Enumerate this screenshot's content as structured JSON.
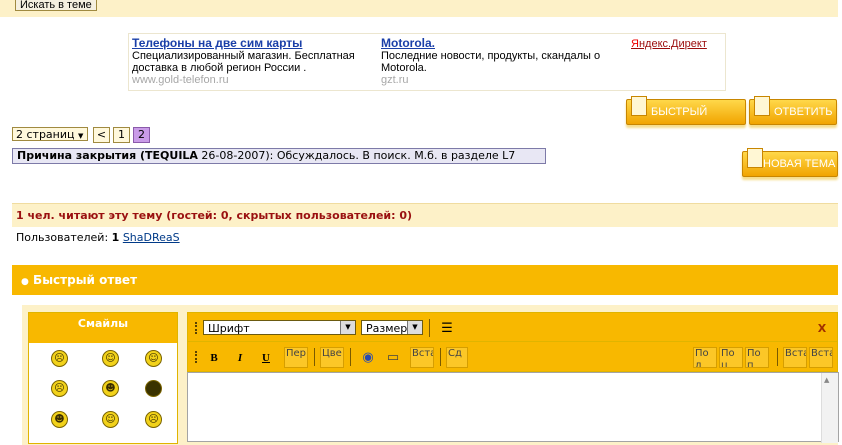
{
  "search_button": "Искать в теме",
  "ads": [
    {
      "title": "Телефоны на две сим карты",
      "text": "Специализированный магазин. Бесплатная доставка в любой регион России .",
      "url": "www.gold-telefon.ru"
    },
    {
      "title": "Motorola.",
      "text": "Последние новости, продукты, скандалы о Motorola.",
      "url": "gzt.ru"
    }
  ],
  "yandex": {
    "first": "Я",
    "rest": "ндекс.Директ"
  },
  "buttons": {
    "quick_reply": "Быстрый ответ",
    "reply": "Ответить",
    "new_topic": "Новая тема"
  },
  "pagination": {
    "pages_label": "2 страниц",
    "prev": "<",
    "pages": [
      "1",
      "2"
    ],
    "current": "2"
  },
  "closure": {
    "prefix": "Причина закрытия (",
    "user": "TEQUILA",
    "date": " 26-08-2007):",
    "text": " Обсуждалось. В поиск. М.б. в разделе L7"
  },
  "readers": "1 чел. читают эту тему (гостей: 0, скрытых пользователей: 0)",
  "users": {
    "label": "Пользователей: ",
    "count": "1",
    "name": "ShaDReaS"
  },
  "quick_reply_header": "Быстрый ответ",
  "smiles": {
    "title": "Смайлы"
  },
  "editor": {
    "font": "Шрифт",
    "size": "Размер",
    "bold": "B",
    "italic": "I",
    "underline": "U",
    "btn_translit": "Пер",
    "btn_color": "Цве",
    "btn_insert": "Вста",
    "btn_sd": "Сд",
    "right_btns": [
      "По л",
      "По ц",
      "По п",
      "Вста",
      "Вста"
    ],
    "close": "X"
  }
}
